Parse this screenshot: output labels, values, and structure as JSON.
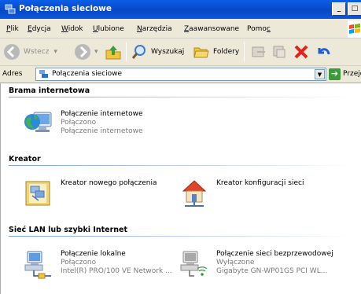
{
  "window": {
    "title": "Połączenia sieciowe",
    "buttons": [
      "_",
      "□"
    ]
  },
  "menu": [
    {
      "key": "P",
      "rest": "lik"
    },
    {
      "key": "E",
      "rest": "dycja"
    },
    {
      "key": "W",
      "rest": "idok"
    },
    {
      "key": "U",
      "rest": "lubione"
    },
    {
      "key": "N",
      "rest": "arzędzia"
    },
    {
      "key": "Z",
      "rest": "aawansowane"
    },
    {
      "key": "",
      "rest": "Pomo",
      "tail": "c"
    }
  ],
  "toolbar": {
    "back": "Wstecz",
    "search": "Wyszukaj",
    "folders": "Foldery"
  },
  "address": {
    "label": "Adres",
    "value": "Połączenia sieciowe",
    "go": "Przejdź"
  },
  "groups": [
    {
      "title": "Brama internetowa"
    },
    {
      "title": "Kreator"
    },
    {
      "title": "Sieć LAN lub szybki Internet"
    }
  ],
  "items": {
    "internet": {
      "name": "Połączenie internetowe",
      "status": "Połączono",
      "device": "Połączenie internetowe"
    },
    "wizard_new": {
      "name": "Kreator nowego połączenia"
    },
    "wizard_net": {
      "name": "Kreator konfiguracji sieci"
    },
    "lan": {
      "name": "Połączenie lokalne",
      "status": "Połączono",
      "device": "Intel(R) PRO/100 VE Network ..."
    },
    "wifi": {
      "name": "Połączenie sieci bezprzewodowej",
      "status": "Wyłączone",
      "device": "Gigabyte GN-WP01GS PCI WL..."
    }
  }
}
